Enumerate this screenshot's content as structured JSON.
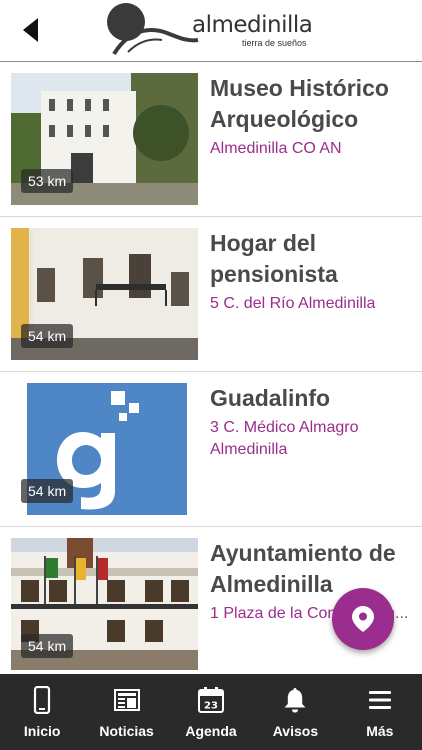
{
  "header": {
    "logo_name": "almedinilla",
    "logo_tagline": "tierra de sueños"
  },
  "places": [
    {
      "title": "Museo Histórico Arqueológico",
      "address": "Almedinilla CO AN",
      "distance": "53 km",
      "thumbnail_icon": "museum-building-photo"
    },
    {
      "title": "Hogar del pensionista",
      "address": "5 C. del Río Almedinilla",
      "distance": "54 km",
      "thumbnail_icon": "building-facade-photo"
    },
    {
      "title": "Guadalinfo",
      "address": "3 C. Médico Almagro Almedinilla",
      "distance": "54 km",
      "thumbnail_icon": "guadalinfo-logo"
    },
    {
      "title": "Ayuntamiento de Almedinilla",
      "address": "1 Plaza de la Constitución...",
      "distance": "54 km",
      "thumbnail_icon": "town-hall-photo"
    }
  ],
  "fab": {
    "icon": "map-pin-icon"
  },
  "tabs": [
    {
      "label": "Inicio",
      "icon": "phone-icon"
    },
    {
      "label": "Noticias",
      "icon": "newspaper-icon"
    },
    {
      "label": "Agenda",
      "icon": "calendar-icon",
      "icon_text": "23"
    },
    {
      "label": "Avisos",
      "icon": "bell-icon"
    },
    {
      "label": "Más",
      "icon": "menu-icon"
    }
  ],
  "colors": {
    "accent": "#9b2d8e",
    "title_text": "#4a4a4a",
    "tabbar_bg": "#2a2a2a"
  }
}
